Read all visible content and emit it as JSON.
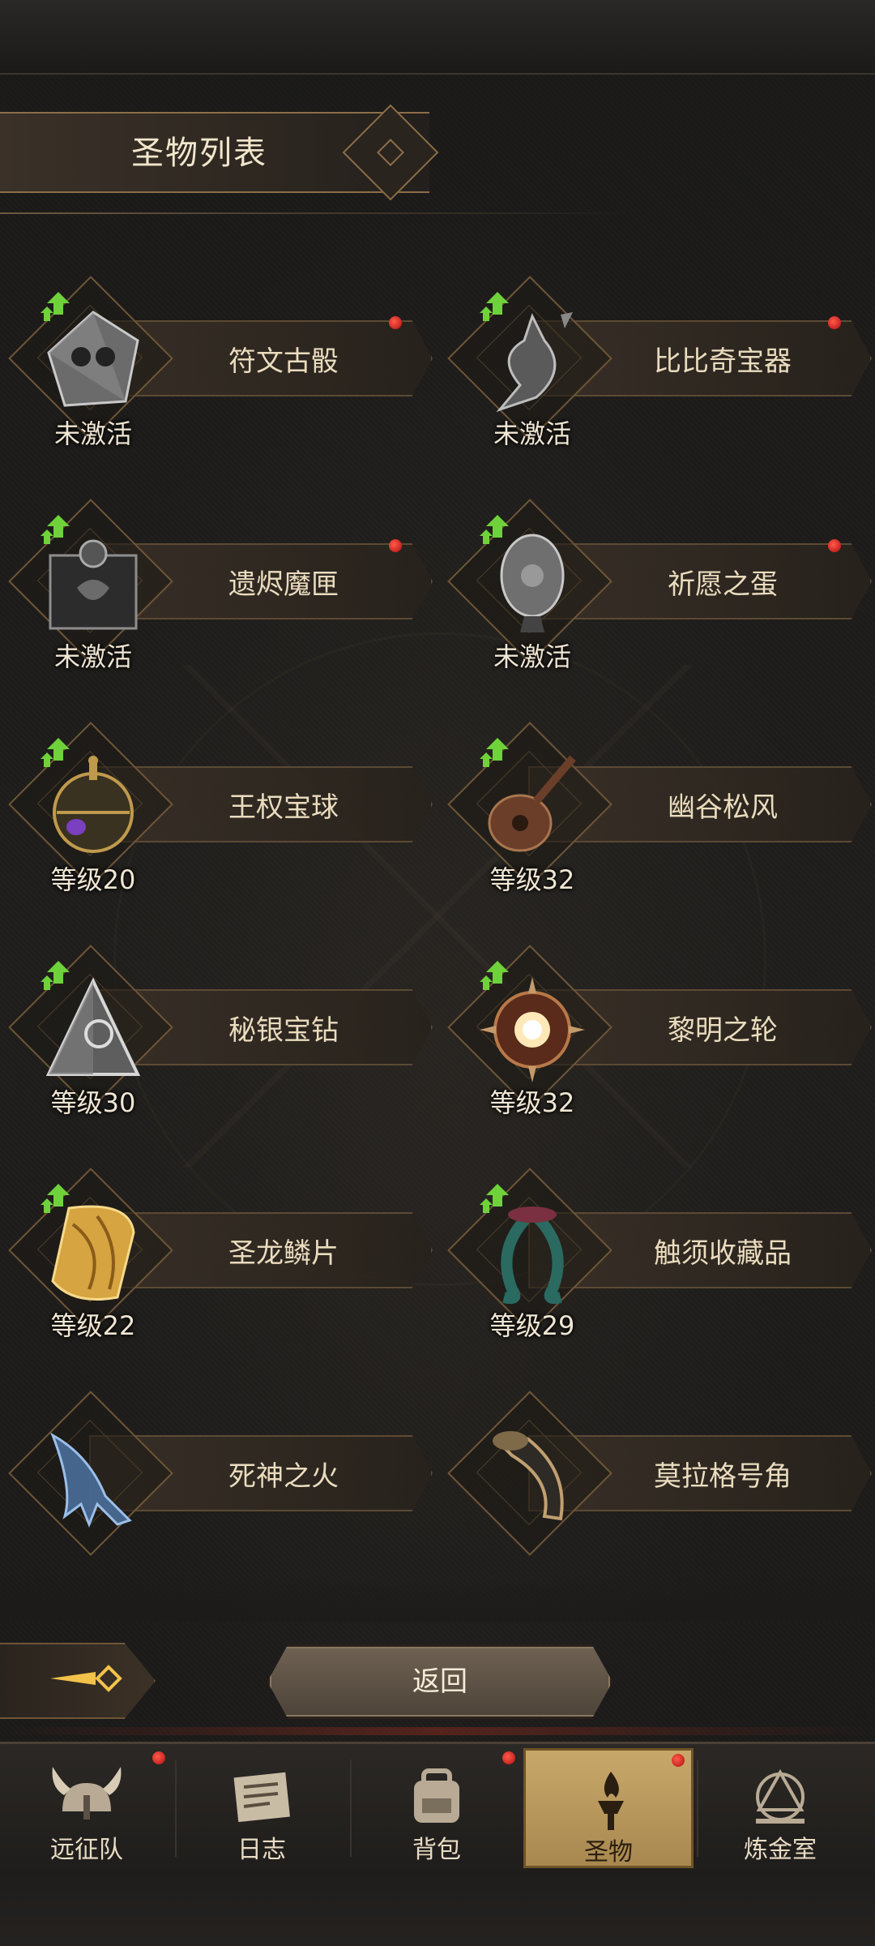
{
  "header": {
    "title": "圣物列表"
  },
  "relics": [
    {
      "name": "符文古骰",
      "status": "未激活",
      "upgradable": true,
      "notify": true,
      "icon": "rune-dice-icon"
    },
    {
      "name": "比比奇宝器",
      "status": "未激活",
      "upgradable": true,
      "notify": true,
      "icon": "treasure-vessel-icon"
    },
    {
      "name": "遗烬魔匣",
      "status": "未激活",
      "upgradable": true,
      "notify": true,
      "icon": "demon-box-icon"
    },
    {
      "name": "祈愿之蛋",
      "status": "未激活",
      "upgradable": true,
      "notify": true,
      "icon": "wish-egg-icon"
    },
    {
      "name": "王权宝球",
      "status": "等级20",
      "upgradable": true,
      "notify": false,
      "icon": "royal-orb-icon"
    },
    {
      "name": "幽谷松风",
      "status": "等级32",
      "upgradable": true,
      "notify": false,
      "icon": "lute-icon"
    },
    {
      "name": "秘银宝钻",
      "status": "等级30",
      "upgradable": true,
      "notify": false,
      "icon": "mithril-pyramid-icon"
    },
    {
      "name": "黎明之轮",
      "status": "等级32",
      "upgradable": true,
      "notify": false,
      "icon": "dawn-wheel-icon"
    },
    {
      "name": "圣龙鳞片",
      "status": "等级22",
      "upgradable": true,
      "notify": false,
      "icon": "dragon-scale-icon"
    },
    {
      "name": "触须收藏品",
      "status": "等级29",
      "upgradable": true,
      "notify": false,
      "icon": "tentacle-icon"
    },
    {
      "name": "死神之火",
      "status": "",
      "upgradable": false,
      "notify": false,
      "icon": "spectral-hand-icon"
    },
    {
      "name": "莫拉格号角",
      "status": "",
      "upgradable": false,
      "notify": false,
      "icon": "war-horn-icon"
    }
  ],
  "controls": {
    "back_label": "返回"
  },
  "nav": {
    "tabs": [
      {
        "label": "远征队",
        "icon": "viking-helmet-icon",
        "notify": true,
        "active": false
      },
      {
        "label": "日志",
        "icon": "scroll-icon",
        "notify": false,
        "active": false
      },
      {
        "label": "背包",
        "icon": "backpack-icon",
        "notify": true,
        "active": false
      },
      {
        "label": "圣物",
        "icon": "torch-icon",
        "notify": true,
        "active": true
      },
      {
        "label": "炼金室",
        "icon": "alchemy-icon",
        "notify": false,
        "active": false
      }
    ]
  },
  "colors": {
    "accent_gold": "#c8a86a",
    "notify_red": "#e02020",
    "upgrade_green": "#6fd23a"
  }
}
